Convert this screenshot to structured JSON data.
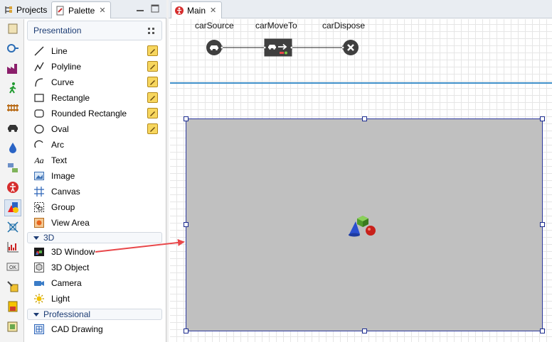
{
  "left_tabs": {
    "projects_label": "Projects",
    "palette_label": "Palette",
    "close_glyph": "✕"
  },
  "palette": {
    "presentation_header": "Presentation",
    "presentation_items": [
      {
        "label": "Line",
        "icon": "line-icon",
        "has_pencil": true
      },
      {
        "label": "Polyline",
        "icon": "polyline-icon",
        "has_pencil": true
      },
      {
        "label": "Curve",
        "icon": "curve-icon",
        "has_pencil": true
      },
      {
        "label": "Rectangle",
        "icon": "rectangle-icon",
        "has_pencil": true
      },
      {
        "label": "Rounded Rectangle",
        "icon": "rounded-rectangle-icon",
        "has_pencil": true
      },
      {
        "label": "Oval",
        "icon": "oval-icon",
        "has_pencil": true
      },
      {
        "label": "Arc",
        "icon": "arc-icon",
        "has_pencil": false
      },
      {
        "label": "Text",
        "icon": "text-icon",
        "has_pencil": false
      },
      {
        "label": "Image",
        "icon": "image-icon",
        "has_pencil": false
      },
      {
        "label": "Canvas",
        "icon": "canvas-icon",
        "has_pencil": false
      },
      {
        "label": "Group",
        "icon": "group-icon",
        "has_pencil": false
      },
      {
        "label": "View Area",
        "icon": "view-area-icon",
        "has_pencil": false
      }
    ],
    "threed_header": "3D",
    "threed_items": [
      {
        "label": "3D Window",
        "icon": "3d-window-icon"
      },
      {
        "label": "3D Object",
        "icon": "3d-object-icon"
      },
      {
        "label": "Camera",
        "icon": "camera-icon"
      },
      {
        "label": "Light",
        "icon": "light-icon"
      }
    ],
    "professional_header": "Professional",
    "professional_items": [
      {
        "label": "CAD Drawing",
        "icon": "cad-drawing-icon"
      }
    ],
    "text_icon_glyph": "Aa"
  },
  "editor": {
    "tab_label": "Main",
    "close_glyph": "✕",
    "blocks": [
      {
        "label": "carSource",
        "icon": "car-source-icon"
      },
      {
        "label": "carMoveTo",
        "icon": "car-move-to-icon"
      },
      {
        "label": "carDispose",
        "icon": "car-dispose-icon"
      }
    ]
  },
  "colors": {
    "section_header_text": "#1c3c74",
    "arrow": "#e8474a",
    "window3d_fill": "#c0c0c0",
    "selection": "#2e3a9e",
    "separator": "#3f8fc9"
  }
}
